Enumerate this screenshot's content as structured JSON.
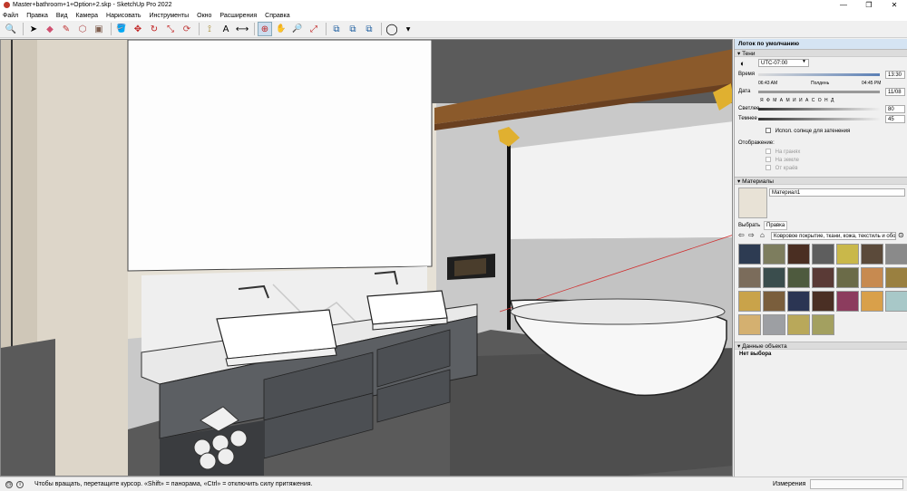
{
  "window": {
    "title": "Master+bathroom+1+Option+2.skp - SketchUp Pro 2022",
    "minimize": "—",
    "maximize": "❐",
    "close": "✕"
  },
  "menu": [
    "Файл",
    "Правка",
    "Вид",
    "Камера",
    "Нарисовать",
    "Инструменты",
    "Окно",
    "Расширения",
    "Справка"
  ],
  "toolbar": [
    {
      "name": "search-icon",
      "glyph": "🔍"
    },
    {
      "name": "select-arrow-icon",
      "glyph": "➤"
    },
    {
      "name": "eraser-icon",
      "glyph": "◆"
    },
    {
      "name": "pencil-icon",
      "glyph": "✎"
    },
    {
      "name": "shapes-icon",
      "glyph": "⬡"
    },
    {
      "name": "pushpull-icon",
      "glyph": "▣"
    },
    {
      "name": "paint-bucket-icon",
      "glyph": "🪣"
    },
    {
      "name": "move-icon",
      "glyph": "✥"
    },
    {
      "name": "rotate-icon",
      "glyph": "↻"
    },
    {
      "name": "scale-icon",
      "glyph": "⤡"
    },
    {
      "name": "offset-icon",
      "glyph": "⟳"
    },
    {
      "name": "tape-measure-icon",
      "glyph": "⟟"
    },
    {
      "name": "text-icon",
      "glyph": "A"
    },
    {
      "name": "dimension-icon",
      "glyph": "⟷"
    },
    {
      "name": "orbit-icon",
      "glyph": "⊕"
    },
    {
      "name": "pan-icon",
      "glyph": "✋"
    },
    {
      "name": "zoom-icon",
      "glyph": "🔎"
    },
    {
      "name": "zoom-extents-icon",
      "glyph": "⤢"
    },
    {
      "name": "warehouse-icon",
      "glyph": "⧉"
    },
    {
      "name": "extension-warehouse-icon",
      "glyph": "⧉"
    },
    {
      "name": "layout-icon",
      "glyph": "⧉"
    },
    {
      "name": "account-icon",
      "glyph": "◯"
    }
  ],
  "tray": {
    "title": "Лоток по умолчанию",
    "shadows": {
      "header": "Тени",
      "timezone": "UTC-07:00",
      "time_label": "Время",
      "time_start": "06:43 AM",
      "time_noon": "Полдень",
      "time_end": "04:45 PM",
      "time_value": "13:30",
      "date_label": "Дата",
      "months": "Я Ф М А М И И А С О Н Д",
      "date_value": "11/08",
      "light_label": "Светлее",
      "light_value": "80",
      "dark_label": "Темнее",
      "dark_value": "45",
      "use_sun": "Испол. солнце для затенения",
      "display_label": "Отображение:",
      "on_faces": "На гранях",
      "on_ground": "На земле",
      "from_edges": "От краёв"
    },
    "materials": {
      "header": "Материалы",
      "name": "Материал1",
      "tab_select": "Выбрать",
      "tab_edit": "Правка",
      "collection": "Ковровое покрытие, ткани, кожа, текстиль и обо",
      "swatches": [
        "#2d3b52",
        "#7d7d5e",
        "#4a2e22",
        "#5e5e5e",
        "#c9b84a",
        "#5b4a3a",
        "#8a8a8a",
        "#7b6c5b",
        "#3a4d4d",
        "#4e5a3e",
        "#5a3a36",
        "#6b6b48",
        "#c78a50",
        "#9a8040",
        "#c9a34a",
        "#7a5e3c",
        "#2b3553",
        "#4a2f24",
        "#8c3c5e",
        "#d9a04a",
        "#a8c8c8",
        "#d4b070",
        "#9d9fa3",
        "#b9a85a",
        "#a3a060"
      ]
    },
    "entity": {
      "header": "Данные объекта",
      "none": "Нет выбора"
    }
  },
  "status": {
    "hint": "Чтобы вращать, перетащите курсор. «Shift» = панорама, «Ctrl» = отключить силу притяжения.",
    "measure_label": "Измерения"
  }
}
